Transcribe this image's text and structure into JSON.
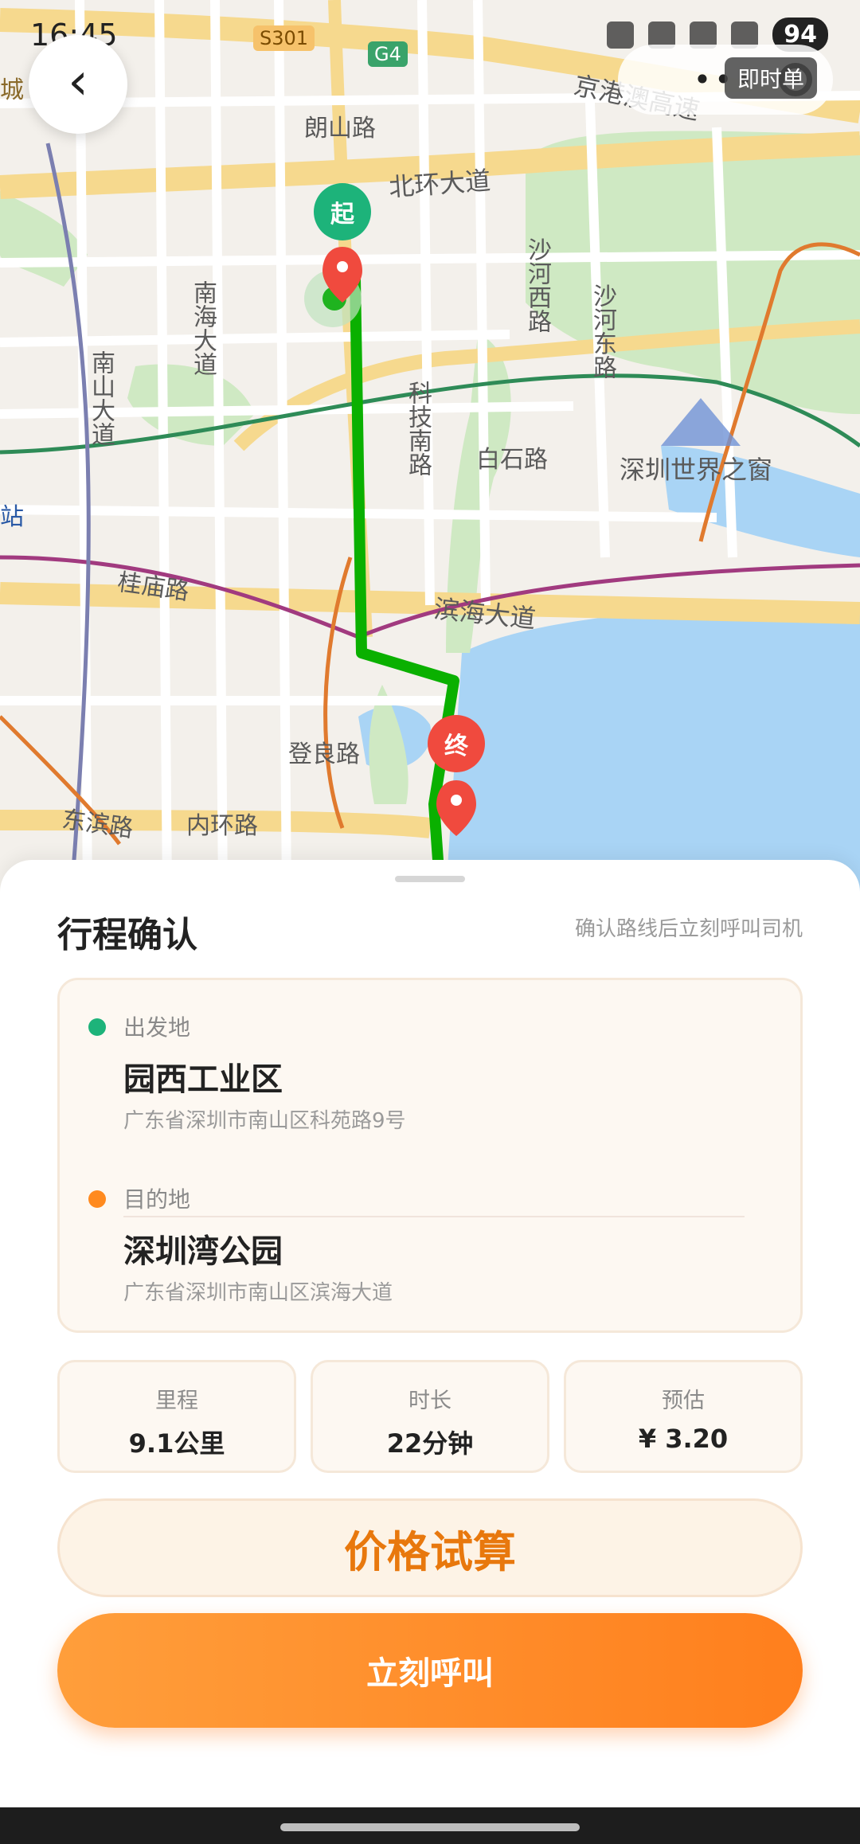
{
  "status_bar": {
    "time": "16:45",
    "battery": "94"
  },
  "map": {
    "order_type": "即时单",
    "labels": {
      "langshan": "朗山路",
      "beihuan": "北环大道",
      "nanhai": "南海大道",
      "nanshan": "南山大道",
      "keji_nan": "科技南路",
      "shahe_xi": "沙河西路",
      "shahe_dong": "沙河东路",
      "baishi": "白石路",
      "window": "深圳世界之窗",
      "guimiao": "桂庙路",
      "binhai": "滨海大道",
      "dengliang": "登良路",
      "dongbin": "东滨路",
      "neihuan": "内环路",
      "jinggang": "京港澳高速",
      "s301": "S301",
      "g4": "G4",
      "station": "站",
      "city_left": "城"
    },
    "start_badge": "起",
    "end_badge": "终"
  },
  "sheet": {
    "title": "行程确认",
    "hint": "确认路线后立刻呼叫司机",
    "origin": {
      "label": "出发地",
      "name": "园西工业区",
      "address": "广东省深圳市南山区科苑路9号"
    },
    "destination": {
      "label": "目的地",
      "name": "深圳湾公园",
      "address": "广东省深圳市南山区滨海大道"
    },
    "stats": [
      {
        "label": "里程",
        "value": "9.1公里"
      },
      {
        "label": "时长",
        "value": "22分钟"
      },
      {
        "label": "预估",
        "value": "¥ 3.20"
      }
    ],
    "calc_button": "价格试算",
    "call_button": "立刻呼叫"
  },
  "colors": {
    "accent": "#ff8a1f",
    "route": "#0ab000",
    "start": "#1db37a",
    "end": "#f04a3e",
    "water": "#a9d4f5",
    "park": "#cfe9c3"
  },
  "icons": [
    "back-icon",
    "more-icon",
    "locate-icon",
    "start-pin-icon",
    "end-pin-icon"
  ]
}
